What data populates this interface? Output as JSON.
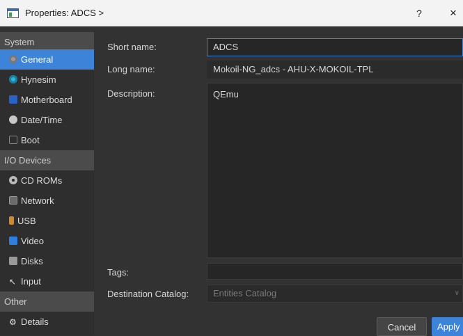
{
  "window": {
    "title": "Properties: ADCS >",
    "help_label": "?",
    "close_label": "×"
  },
  "sidebar": {
    "sections": [
      {
        "header": "System",
        "items": [
          {
            "label": "General",
            "icon": "gear-icon",
            "selected": true
          },
          {
            "label": "Hynesim",
            "icon": "hynesim-icon"
          },
          {
            "label": "Motherboard",
            "icon": "motherboard-icon"
          },
          {
            "label": "Date/Time",
            "icon": "clock-icon"
          },
          {
            "label": "Boot",
            "icon": "boot-icon"
          }
        ]
      },
      {
        "header": "I/O Devices",
        "items": [
          {
            "label": "CD ROMs",
            "icon": "cd-icon"
          },
          {
            "label": "Network",
            "icon": "network-icon"
          },
          {
            "label": "USB",
            "icon": "usb-icon"
          },
          {
            "label": "Video",
            "icon": "video-icon"
          },
          {
            "label": "Disks",
            "icon": "disk-icon"
          },
          {
            "label": "Input",
            "icon": "cursor-icon"
          }
        ]
      },
      {
        "header": "Other",
        "items": [
          {
            "label": "Details",
            "icon": "details-icon"
          }
        ]
      }
    ]
  },
  "form": {
    "short_name": {
      "label": "Short name:",
      "value": "ADCS"
    },
    "long_name": {
      "label": "Long name:",
      "value": "Mokoil-NG_adcs - AHU-X-MOKOIL-TPL"
    },
    "description": {
      "label": "Description:",
      "value": "QEmu"
    },
    "tags": {
      "label": "Tags:",
      "value": ""
    },
    "destination_catalog": {
      "label": "Destination Catalog:",
      "value": "Entities Catalog"
    }
  },
  "buttons": {
    "cancel": "Cancel",
    "apply": "Apply"
  },
  "colors": {
    "accent": "#3d83d9",
    "background": "#323232",
    "sidebar_header": "#4b4b4b"
  }
}
